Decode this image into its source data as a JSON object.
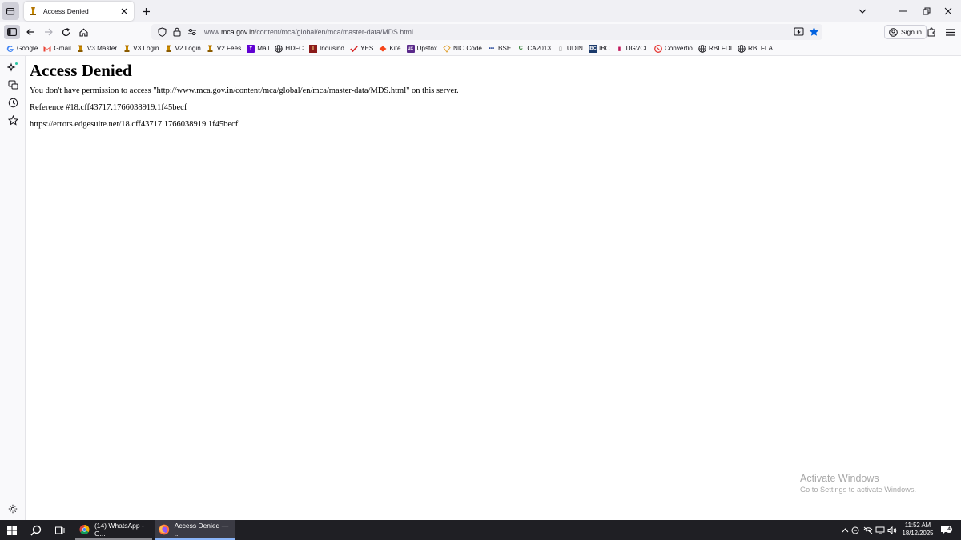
{
  "tabs": [
    {
      "title": "Access Denied",
      "active": true
    }
  ],
  "toolbar": {
    "url_prefix": "www.",
    "url_domain": "mca.gov.in",
    "url_path": "/content/mca/global/en/mca/master-data/MDS.html",
    "signin_label": "Sign in"
  },
  "bookmarks": [
    {
      "label": "Google",
      "icon": "google-icon"
    },
    {
      "label": "Gmail",
      "icon": "gmail-icon"
    },
    {
      "label": "V3 Master",
      "icon": "emblem-icon"
    },
    {
      "label": "V3 Login",
      "icon": "emblem-icon"
    },
    {
      "label": "V2 Login",
      "icon": "emblem-icon"
    },
    {
      "label": "V2 Fees",
      "icon": "emblem-icon"
    },
    {
      "label": "Mail",
      "icon": "yahoo-icon"
    },
    {
      "label": "HDFC",
      "icon": "globe-icon"
    },
    {
      "label": "Indusind",
      "icon": "indusind-icon"
    },
    {
      "label": "YES",
      "icon": "yes-icon"
    },
    {
      "label": "Kite",
      "icon": "kite-icon"
    },
    {
      "label": "Upstox",
      "icon": "upstox-icon"
    },
    {
      "label": "NIC Code",
      "icon": "nic-icon"
    },
    {
      "label": "BSE",
      "icon": "bse-icon"
    },
    {
      "label": "CA2013",
      "icon": "ca-icon"
    },
    {
      "label": "UDIN",
      "icon": "udin-icon"
    },
    {
      "label": "IBC",
      "icon": "ibc-icon"
    },
    {
      "label": "DGVCL",
      "icon": "dgvcl-icon"
    },
    {
      "label": "Convertio",
      "icon": "convertio-icon"
    },
    {
      "label": "RBI FDI",
      "icon": "globe-icon"
    },
    {
      "label": "RBI FLA",
      "icon": "globe-icon"
    }
  ],
  "page": {
    "heading": "Access Denied",
    "message": "You don't have permission to access \"http://www.mca.gov.in/content/mca/global/en/mca/master-data/MDS.html\" on this server.",
    "reference": "Reference #18.cff43717.1766038919.1f45becf",
    "error_url": "https://errors.edgesuite.net/18.cff43717.1766038919.1f45becf"
  },
  "watermark": {
    "line1": "Activate Windows",
    "line2": "Go to Settings to activate Windows."
  },
  "taskbar": {
    "apps": [
      {
        "label": "(14) WhatsApp - G...",
        "icon": "chrome-icon"
      },
      {
        "label": "Access Denied — ...",
        "icon": "firefox-icon"
      }
    ],
    "time": "11:52 AM",
    "date": "18/12/2025",
    "notification_count": "4"
  },
  "colors": {
    "accent_blue": "#0061e0",
    "tab_strip": "#f0f0f4",
    "taskbar": "#1f1f24"
  }
}
